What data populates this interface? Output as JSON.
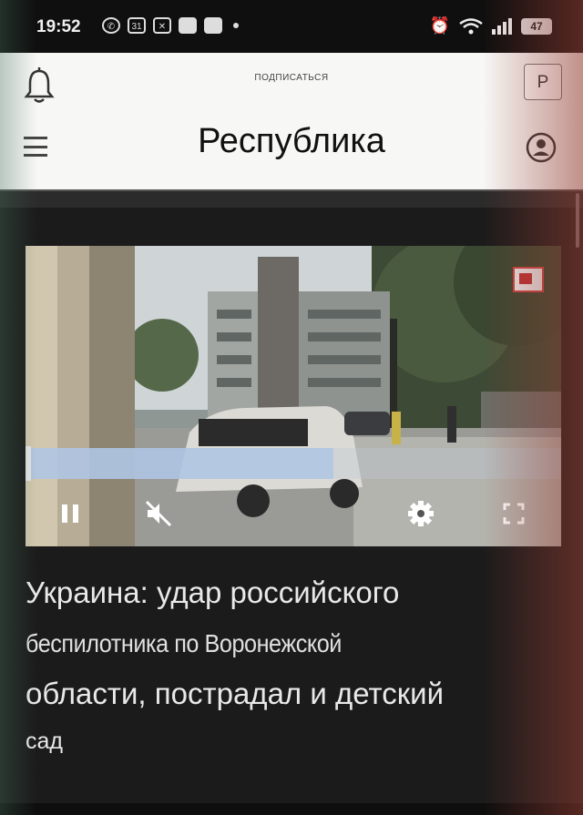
{
  "status_bar": {
    "time": "19:52",
    "notification_icons": [
      "whatsapp-icon",
      "calendar-icon",
      "app-icon",
      "message-icon",
      "message-icon"
    ],
    "calendar_day": "31",
    "battery": "47",
    "right_icons": [
      "alarm-icon",
      "wifi-icon",
      "signal-icon",
      "battery-icon"
    ]
  },
  "header": {
    "subscribe_label": "ПОДПИСАТЬСЯ",
    "p_button_label": "P",
    "site_title": "Республика",
    "background": "#f7f7f5"
  },
  "video": {
    "progress_fraction": 0.57,
    "controls": [
      "pause-icon",
      "mute-icon",
      "settings-icon",
      "fullscreen-icon"
    ],
    "cast_icon": "cast-icon"
  },
  "article": {
    "headline_lines": [
      "Украина: удар российского",
      "беспилотника по Воронежской",
      "области, пострадал и детский",
      "сад"
    ]
  },
  "colors": {
    "page_background": "#1b1b1b",
    "headline_text": "#e9e9e9",
    "progress_fill": "#afc6e4"
  }
}
